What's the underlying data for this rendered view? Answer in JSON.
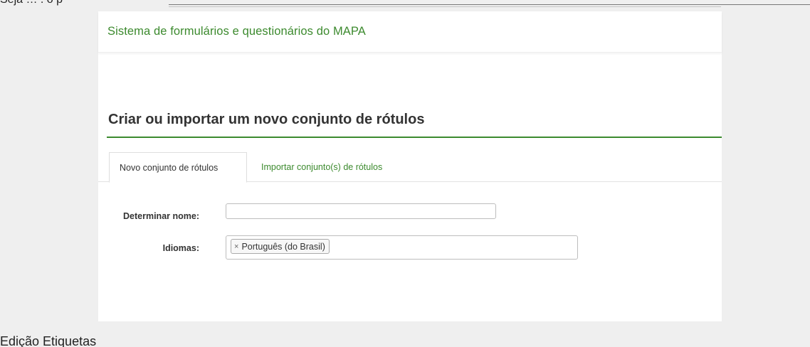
{
  "document": {
    "top_fragment": "Seja … . o p",
    "caption": "Edição Etiquetas"
  },
  "header": {
    "site_title": "Sistema de formulários e questionários do MAPA"
  },
  "section": {
    "title": "Criar ou importar um novo conjunto de rótulos"
  },
  "tabs": [
    {
      "label": "Novo conjunto de rótulos",
      "active": true
    },
    {
      "label": "Importar conjunto(s) de rótulos",
      "active": false
    }
  ],
  "form": {
    "name_label": "Determinar nome:",
    "name_value": "",
    "languages_label": "Idiomas:",
    "selected_language": "Português (do Brasil)",
    "remove_symbol": "×"
  },
  "colors": {
    "accent_green": "#3c8a2e",
    "page_background": "#efefef",
    "panel_background": "#ffffff"
  }
}
